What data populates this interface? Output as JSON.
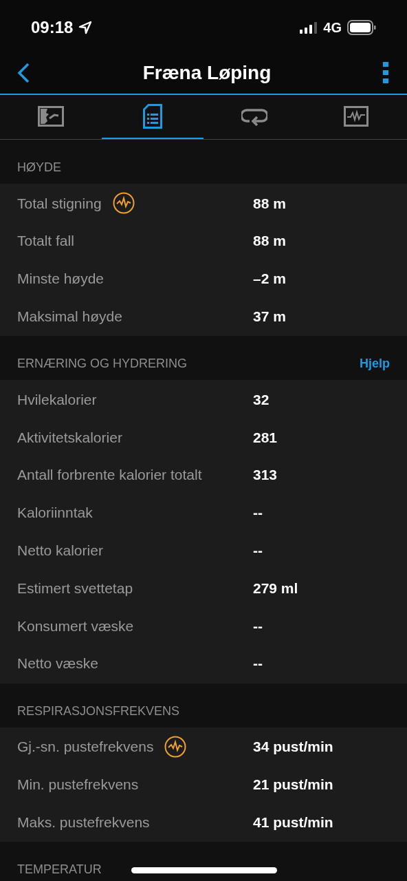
{
  "status_bar": {
    "time": "09:18",
    "network": "4G"
  },
  "nav": {
    "title": "Fræna Løping"
  },
  "tabs": [
    {
      "kind": "map",
      "selected": false
    },
    {
      "kind": "list",
      "selected": true
    },
    {
      "kind": "laps",
      "selected": false
    },
    {
      "kind": "chart",
      "selected": false
    }
  ],
  "sections": [
    {
      "title": "HØYDE",
      "rows": [
        {
          "label": "Total stigning",
          "value": "88 m",
          "graph_icon": true
        },
        {
          "label": "Totalt fall",
          "value": "88 m",
          "graph_icon": false
        },
        {
          "label": "Minste høyde",
          "value": "–2 m",
          "graph_icon": false
        },
        {
          "label": "Maksimal høyde",
          "value": "37 m",
          "graph_icon": false
        }
      ]
    },
    {
      "title": "ERNÆRING OG HYDRERING",
      "link": "Hjelp",
      "rows": [
        {
          "label": "Hvilekalorier",
          "value": "32",
          "graph_icon": false
        },
        {
          "label": "Aktivitetskalorier",
          "value": "281",
          "graph_icon": false
        },
        {
          "label": "Antall forbrente kalorier totalt",
          "value": "313",
          "graph_icon": false
        },
        {
          "label": "Kaloriinntak",
          "value": "--",
          "graph_icon": false
        },
        {
          "label": "Netto kalorier",
          "value": "--",
          "graph_icon": false
        },
        {
          "label": "Estimert svettetap",
          "value": "279 ml",
          "graph_icon": false
        },
        {
          "label": "Konsumert væske",
          "value": "--",
          "graph_icon": false
        },
        {
          "label": "Netto væske",
          "value": "--",
          "graph_icon": false
        }
      ]
    },
    {
      "title": "RESPIRASJONSFREKVENS",
      "rows": [
        {
          "label": "Gj.-sn. pustefrekvens",
          "value": "34 pust/min",
          "graph_icon": true
        },
        {
          "label": "Min. pustefrekvens",
          "value": "21 pust/min",
          "graph_icon": false
        },
        {
          "label": "Maks. pustefrekvens",
          "value": "41 pust/min",
          "graph_icon": false
        }
      ]
    },
    {
      "title": "TEMPERATUR"
    }
  ]
}
